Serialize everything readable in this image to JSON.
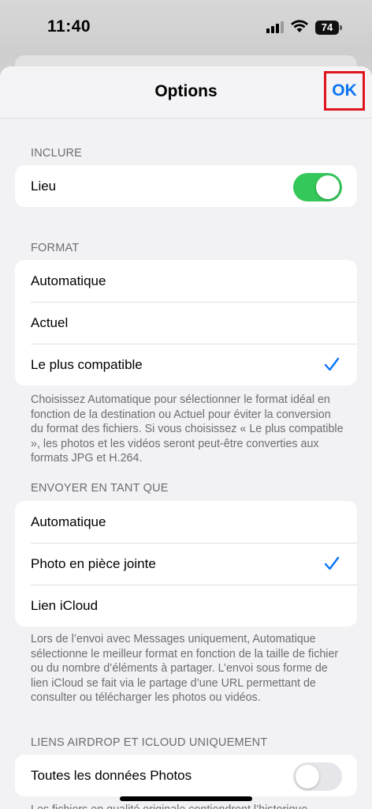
{
  "status": {
    "time": "11:40",
    "battery": "74"
  },
  "nav": {
    "title": "Options",
    "ok_label": "OK"
  },
  "include": {
    "header": "INCLURE",
    "location_label": "Lieu",
    "location_on": true
  },
  "format": {
    "header": "FORMAT",
    "options": [
      "Automatique",
      "Actuel",
      "Le plus compatible"
    ],
    "selected": "Le plus compatible",
    "footnote": "Choisissez Automatique pour sélectionner le format idéal en fonction de la destination ou Actuel pour éviter la conversion du format des fichiers. Si vous choisissez « Le plus compatible », les photos et les vidéos seront peut-être converties aux formats JPG et H.264."
  },
  "send_as": {
    "header": "ENVOYER EN TANT QUE",
    "options": [
      "Automatique",
      "Photo en pièce jointe",
      "Lien iCloud"
    ],
    "selected": "Photo en pièce jointe",
    "footnote": "Lors de l’envoi avec Messages uniquement, Automatique sélectionne le meilleur format en fonction de la taille de fichier ou du nombre d’éléments à partager. L’envoi sous forme de lien iCloud se fait via le partage d’une URL permettant de consulter ou télécharger les photos ou vidéos."
  },
  "airdrop": {
    "header": "LIENS AIRDROP ET ICLOUD UNIQUEMENT",
    "all_data_label": "Toutes les données Photos",
    "all_data_on": false,
    "footnote": "Les fichiers en qualité originale contiendront l’historique"
  },
  "colors": {
    "accent": "#0a74f5",
    "toggle_on": "#34c759",
    "highlight": "#e0141e"
  }
}
